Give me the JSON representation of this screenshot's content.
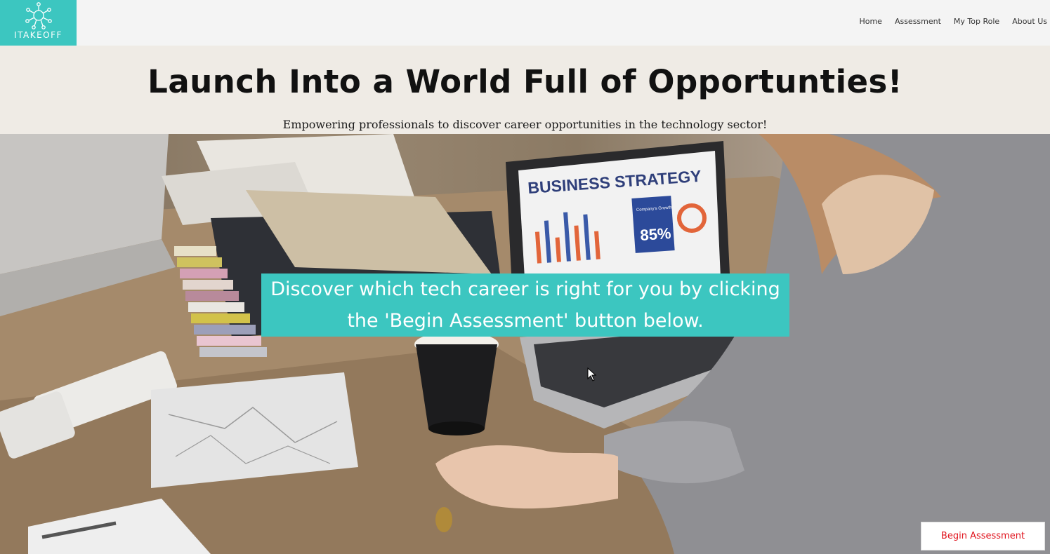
{
  "brand": {
    "name": "ITAKEOFF",
    "color": "#3cc6c0"
  },
  "nav": {
    "items": [
      {
        "label": "Home"
      },
      {
        "label": "Assessment"
      },
      {
        "label": "My Top Role"
      },
      {
        "label": "About Us"
      }
    ]
  },
  "hero": {
    "title": "Launch Into a World Full of Opportunties!",
    "subtitle": "Empowering professionals to discover career opportunities in the technology sector!",
    "image_screen_text": {
      "headline": "BUSINESS STRATEGY",
      "box_label": "Company's Growth",
      "percent": "85%"
    },
    "callout": "Discover which tech career is right for you by clicking the 'Begin Assessment' button below."
  },
  "cta": {
    "label": "Begin Assessment",
    "color": "#e0141e"
  }
}
